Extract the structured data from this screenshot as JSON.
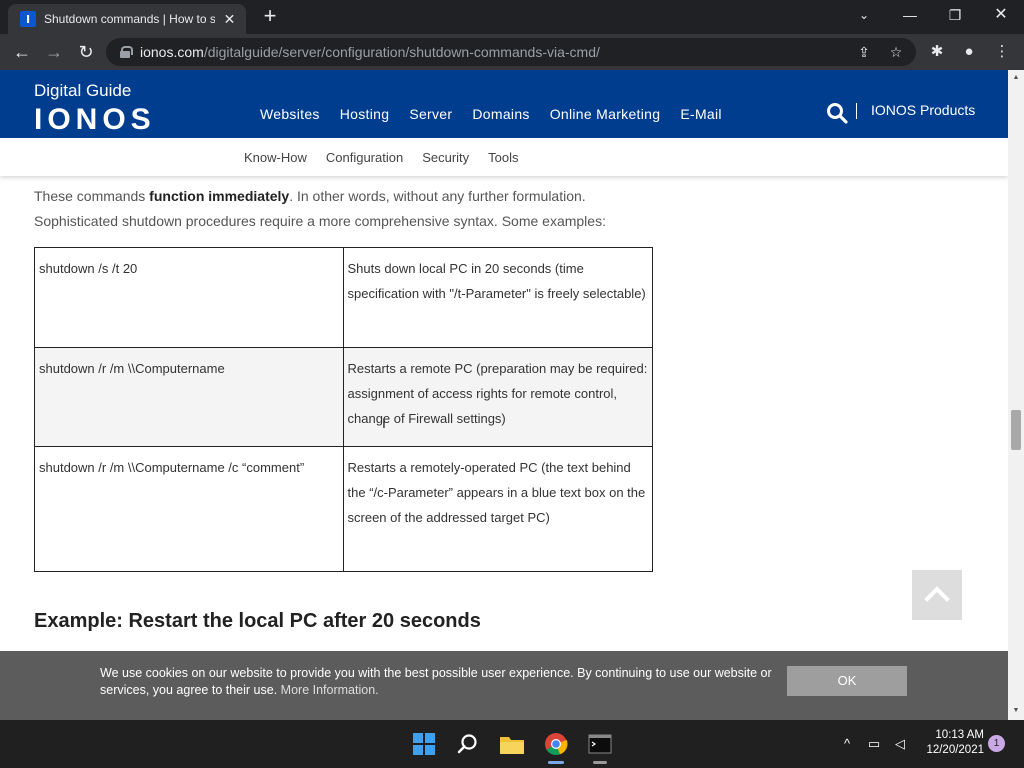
{
  "browser": {
    "tab_title": "Shutdown commands | How to sh",
    "favicon_letter": "I",
    "close_tab": "✕",
    "new_tab": "+",
    "url_domain": "ionos.com",
    "url_path": "/digitalguide/server/configuration/shutdown-commands-via-cmd/"
  },
  "header": {
    "brand_top": "Digital Guide",
    "brand_logo": "IONOS",
    "nav": [
      "Websites",
      "Hosting",
      "Server",
      "Domains",
      "Online Marketing",
      "E-Mail"
    ],
    "products": "IONOS Products",
    "sub_nav": [
      "Know-How",
      "Configuration",
      "Security",
      "Tools"
    ]
  },
  "article": {
    "intro_prefix": "These commands ",
    "intro_bold": "function immediately",
    "intro_suffix": ". In other words, without any further formulation. Sophisticated shutdown procedures require a more comprehensive syntax. Some examples:",
    "table": [
      {
        "command": "shutdown /s /t 20",
        "description": "Shuts down local PC in 20 seconds (time specification with \"/t-Parameter\" is freely selectable)"
      },
      {
        "command": "shutdown /r /m \\\\Computername",
        "description": "Restarts a remote PC (preparation may be required: assignment of access rights for remote control, change of Firewall settings)"
      },
      {
        "command": "shutdown /r /m \\\\Computername /c “comment”",
        "description": "Restarts a remotely-operated PC (the text behind the “/c-Parameter” appears in a blue text box on the screen of the addressed target PC)"
      }
    ],
    "example_heading": "Example: Restart the local PC after 20 seconds"
  },
  "cookie": {
    "text": "We use cookies on our website to provide you with the best possible user experience. By continuing to use our website or services, you agree to their use.",
    "link": "More Information.",
    "ok": "OK"
  },
  "taskbar": {
    "time": "10:13 AM",
    "date": "12/20/2021",
    "notifications": "1"
  },
  "colors": {
    "ionos_blue": "#003d8f",
    "chrome_dark": "#202124"
  }
}
